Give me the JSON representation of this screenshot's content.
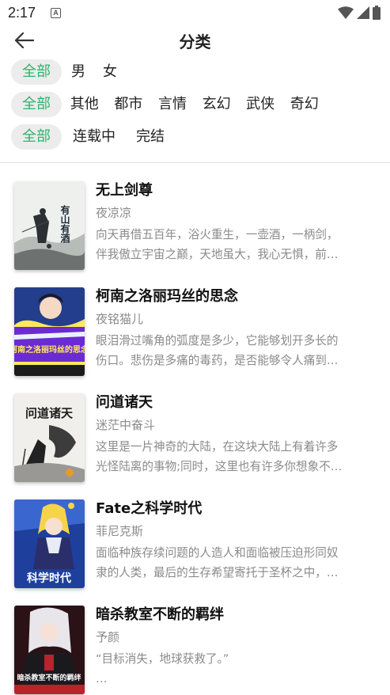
{
  "status_bar": {
    "time": "2:17",
    "notif_letter": "A"
  },
  "header": {
    "title": "分类"
  },
  "filters": {
    "gender": [
      {
        "label": "全部",
        "active": true
      },
      {
        "label": "男",
        "active": false
      },
      {
        "label": "女",
        "active": false
      }
    ],
    "genre": [
      {
        "label": "全部",
        "active": true
      },
      {
        "label": "其他",
        "active": false
      },
      {
        "label": "都市",
        "active": false
      },
      {
        "label": "言情",
        "active": false
      },
      {
        "label": "玄幻",
        "active": false
      },
      {
        "label": "武侠",
        "active": false
      },
      {
        "label": "奇幻",
        "active": false
      }
    ],
    "status": [
      {
        "label": "全部",
        "active": true
      },
      {
        "label": "连载中",
        "active": false
      },
      {
        "label": "完结",
        "active": false
      }
    ]
  },
  "colors": {
    "accent": "#2db36b",
    "chip_bg": "#ececec",
    "muted_text": "#8a8a8a"
  },
  "books": [
    {
      "title": "无上剑尊",
      "author": "夜凉凉",
      "desc_line1": "向天再借五百年，浴火重生，一壶酒，一柄剑，",
      "desc_line2": "伴我傲立宇宙之巅，天地虽大，我心无惧，前…",
      "cover_text": "有山有酒"
    },
    {
      "title": "柯南之洛丽玛丝的思念",
      "author": "夜铭猫儿",
      "desc_line1": "眼泪滑过嘴角的弧度是多少，它能够划开多长的",
      "desc_line2": "伤口。悲伤是多痛的毒药，是否能够令人痛到…",
      "cover_text": "柯南之洛丽玛丝的思念"
    },
    {
      "title": "问道诸天",
      "author": "迷茫中奋斗",
      "desc_line1": "这里是一片神奇的大陆，在这块大陆上有着许多",
      "desc_line2": "光怪陆离的事物;同时，这里也有许多你想象不…",
      "cover_text": "问道诸天"
    },
    {
      "title": "Fate之科学时代",
      "author": "菲尼克斯",
      "desc_line1": "面临种族存续问题的人造人和面临被压迫形同奴",
      "desc_line2": "隶的人类，最后的生存希望寄托于圣杯之中，…",
      "cover_text": "科学时代"
    },
    {
      "title": "暗杀教室不断的羁绊",
      "author": "予颜",
      "desc_line1": "“目标消失，地球获救了。”",
      "desc_line2": "…",
      "cover_text": "暗杀教室不断的羁绊"
    }
  ]
}
